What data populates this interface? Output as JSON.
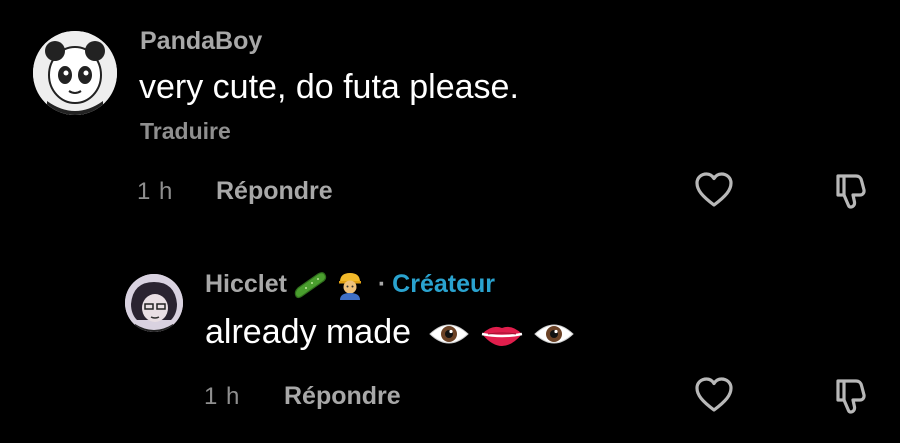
{
  "comments": [
    {
      "username": "PandaBoy",
      "text": "very cute, do futa please.",
      "translate_label": "Traduire",
      "time": "1 h",
      "reply_label": "Répondre"
    },
    {
      "username": "Hicclet",
      "separator": "·",
      "role": "Créateur",
      "text": "already made",
      "time": "1 h",
      "reply_label": "Répondre"
    }
  ],
  "colors": {
    "background": "#000000",
    "creator_badge": "#2aa3cf",
    "muted_text": "#a8a8a8"
  },
  "icons": [
    "heart-icon",
    "dislike-icon",
    "cucumber-emoji",
    "construction-worker-emoji",
    "eye-emoji",
    "lips-emoji"
  ]
}
